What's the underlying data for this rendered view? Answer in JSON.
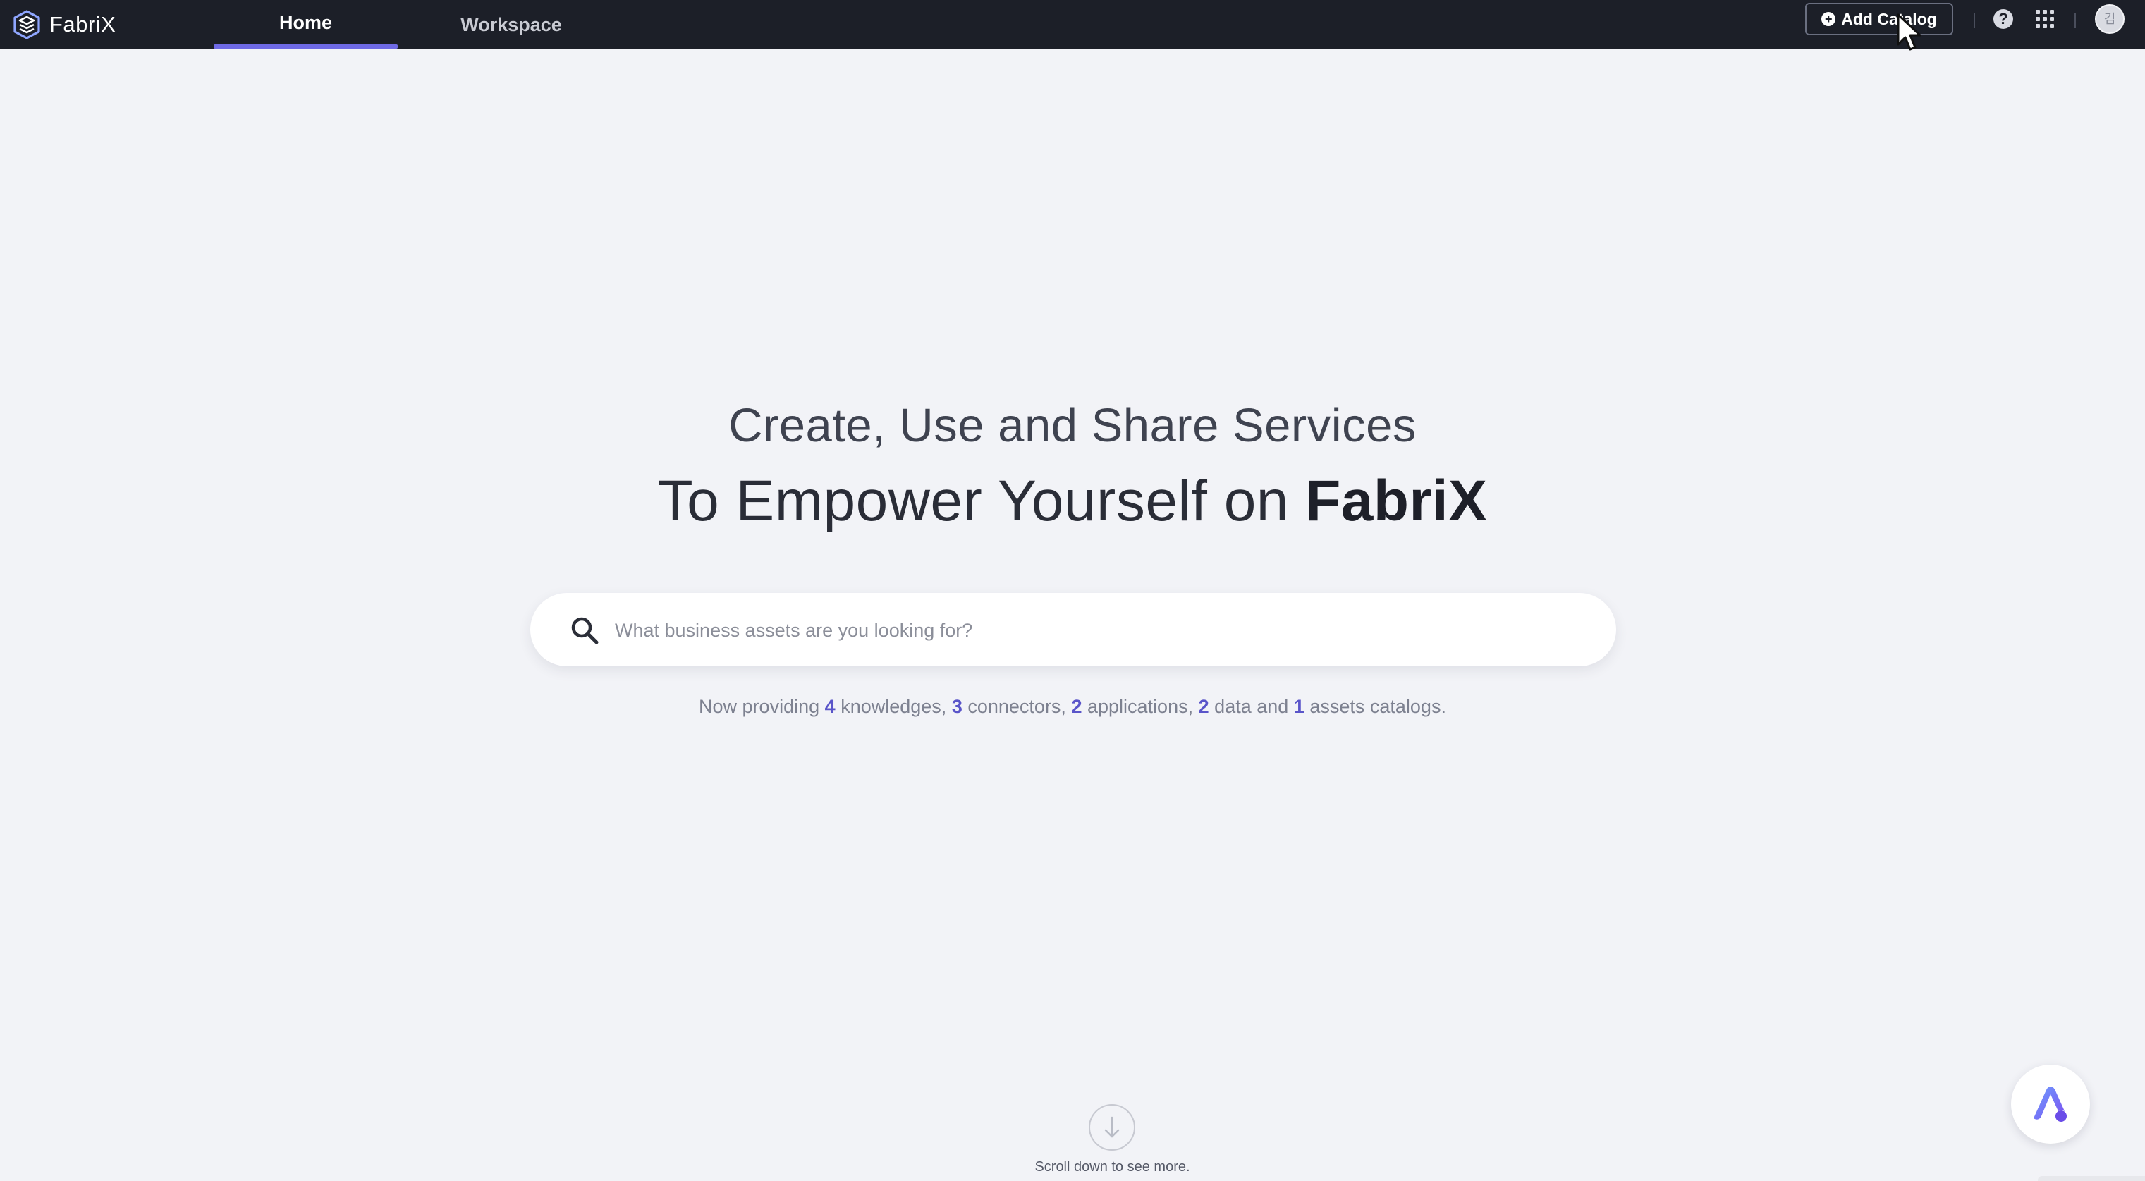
{
  "header": {
    "brand": "FabriX",
    "tabs": [
      {
        "label": "Home",
        "active": true
      },
      {
        "label": "Workspace",
        "active": false
      }
    ],
    "add_catalog_label": "Add Catalog",
    "help_icon": "question-circle-icon",
    "apps_icon": "grid-icon",
    "avatar_initial": "김"
  },
  "hero": {
    "line1": "Create, Use and Share Services",
    "line2_prefix": "To Empower Yourself on ",
    "line2_brand": "FabriX"
  },
  "search": {
    "placeholder": "What business assets are you looking for?",
    "value": ""
  },
  "stats": {
    "prefix": "Now providing",
    "knowledges_count": "4",
    "knowledges_label": "knowledges,",
    "connectors_count": "3",
    "connectors_label": "connectors,",
    "applications_count": "2",
    "applications_label": "applications,",
    "data_count": "2",
    "data_label": "data and",
    "assets_count": "1",
    "assets_label": "assets catalogs."
  },
  "scroll_hint": "Scroll down to see more.",
  "colors": {
    "topbar_bg": "#1c1f28",
    "page_bg": "#f2f3f7",
    "accent": "#6f6ae6",
    "stat_number": "#5a55c9"
  }
}
